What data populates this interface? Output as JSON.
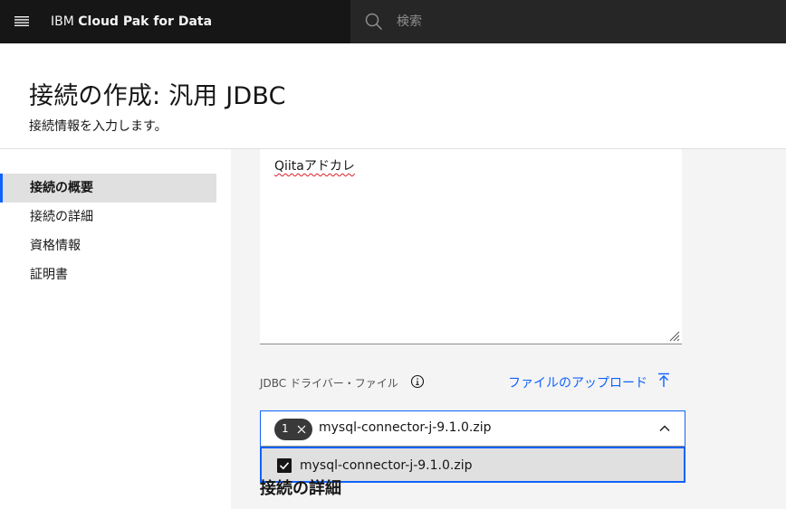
{
  "topbar": {
    "brand_prefix": "IBM",
    "brand_name": "Cloud Pak for Data",
    "search_placeholder": "検索"
  },
  "header": {
    "title": "接続の作成: 汎用 JDBC",
    "subtitle": "接続情報を入力します。"
  },
  "sidenav": {
    "items": [
      {
        "label": "接続の概要",
        "active": true
      },
      {
        "label": "接続の詳細",
        "active": false
      },
      {
        "label": "資格情報",
        "active": false
      },
      {
        "label": "証明書",
        "active": false
      }
    ]
  },
  "form": {
    "description_value": "Qiitaアドカレ",
    "driver_label": "JDBC ドライバー・ファイル",
    "upload_label": "ファイルのアップロード",
    "selected_count": "1",
    "selected_value": "mysql-connector-j-9.1.0.zip",
    "options": [
      {
        "label": "mysql-connector-j-9.1.0.zip",
        "checked": true
      }
    ],
    "next_section_heading": "接続の詳細"
  },
  "colors": {
    "topbar_bg": "#161616",
    "search_bg": "#262626",
    "accent": "#0f62fe",
    "panel_bg": "#f4f4f4"
  }
}
